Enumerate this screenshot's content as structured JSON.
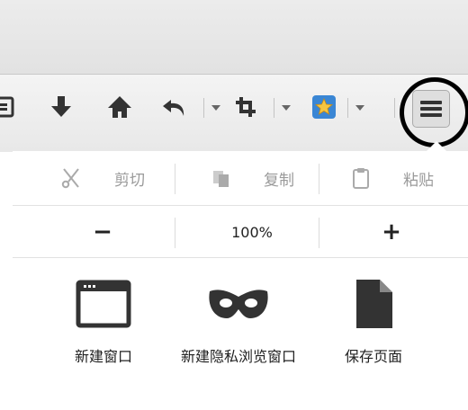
{
  "menu_panel": {
    "edit": {
      "cut_label": "剪切",
      "copy_label": "复制",
      "paste_label": "粘贴"
    },
    "zoom": {
      "zoom_out_label": "−",
      "level": "100%",
      "zoom_in_label": "+"
    },
    "items": [
      {
        "label": "新建窗口",
        "icon": "window-icon"
      },
      {
        "label": "新建隐私浏览窗口",
        "icon": "private-mask-icon"
      },
      {
        "label": "保存页面",
        "icon": "page-icon"
      }
    ]
  },
  "toolbar": {
    "icons": [
      "bookmarks-icon",
      "download-arrow-icon",
      "home-icon",
      "undo-arrow-icon",
      "crop-icon",
      "star-addon-icon",
      "hamburger-menu-icon"
    ]
  },
  "colors": {
    "icon_dark": "#333333",
    "disabled_text": "#9a9a9a",
    "highlight_ring": "#000000",
    "star_badge": "#3a86d4",
    "star": "#f4c542"
  }
}
